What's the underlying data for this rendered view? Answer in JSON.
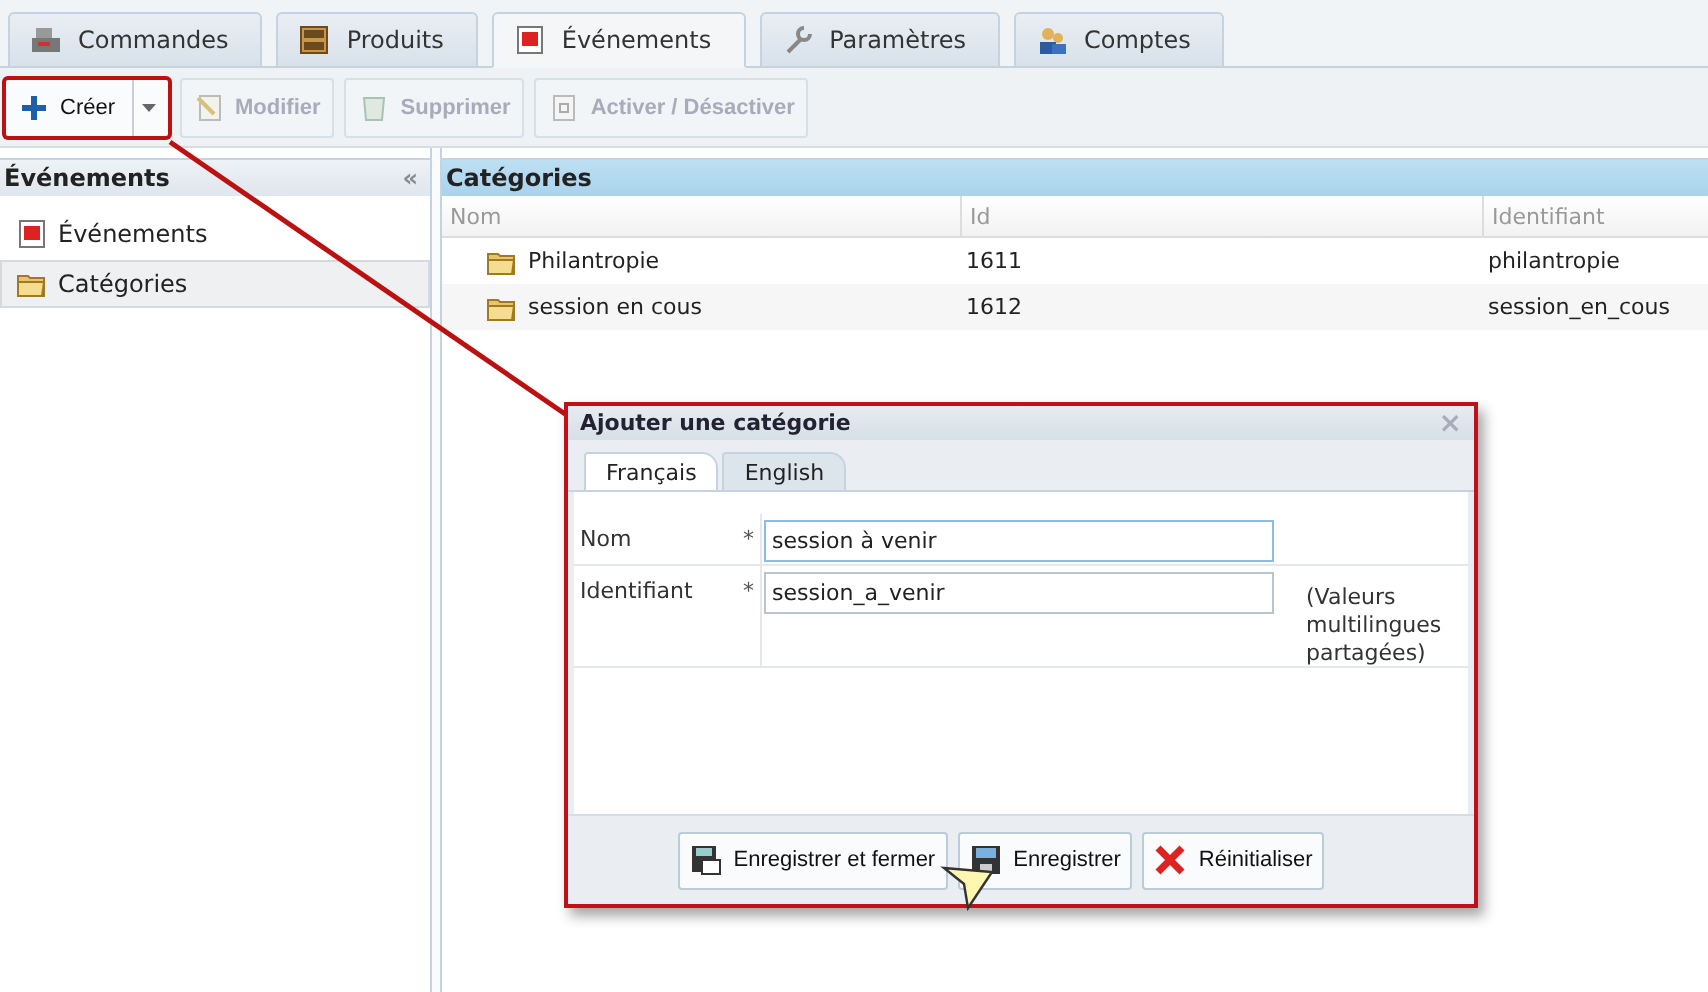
{
  "tabs": [
    {
      "label": "Commandes",
      "selected": false
    },
    {
      "label": "Produits",
      "selected": false
    },
    {
      "label": "Événements",
      "selected": true
    },
    {
      "label": "Paramètres",
      "selected": false
    },
    {
      "label": "Comptes",
      "selected": false
    }
  ],
  "toolbar": [
    {
      "label": "Créer",
      "disabled": false,
      "highlighted": true,
      "menu": true
    },
    {
      "label": "Modifier",
      "disabled": true,
      "highlighted": false,
      "menu": false
    },
    {
      "label": "Supprimer",
      "disabled": true,
      "highlighted": false,
      "menu": false
    },
    {
      "label": "Activer / Désactiver",
      "disabled": true,
      "highlighted": false,
      "menu": false
    }
  ],
  "sidebar": {
    "title": "Événements",
    "collapse": "«",
    "items": [
      {
        "label": "Événements",
        "selected": false
      },
      {
        "label": "Catégories",
        "selected": true
      }
    ]
  },
  "grid": {
    "title": "Catégories",
    "columns": [
      "Nom",
      "Id",
      "Identifiant"
    ],
    "rows": [
      [
        "Philantropie",
        "1611",
        "philantropie"
      ],
      [
        "session en cous",
        "1612",
        "session_en_cous"
      ]
    ]
  },
  "dialog": {
    "title": "Ajouter une catégorie",
    "close": "×",
    "tabs": [
      {
        "label": "Français",
        "selected": true
      },
      {
        "label": "English",
        "selected": false
      }
    ],
    "fields": [
      {
        "label": "Nom",
        "required_mark": "*",
        "value": "session à venir",
        "focused": true
      },
      {
        "label": "Identifiant",
        "required_mark": "*",
        "value": "session_a_venir",
        "focused": false,
        "note": "(Valeurs multilingues partagées)"
      }
    ],
    "buttons": [
      "Enregistrer et fermer",
      "Enregistrer",
      "Réinitialiser"
    ]
  }
}
